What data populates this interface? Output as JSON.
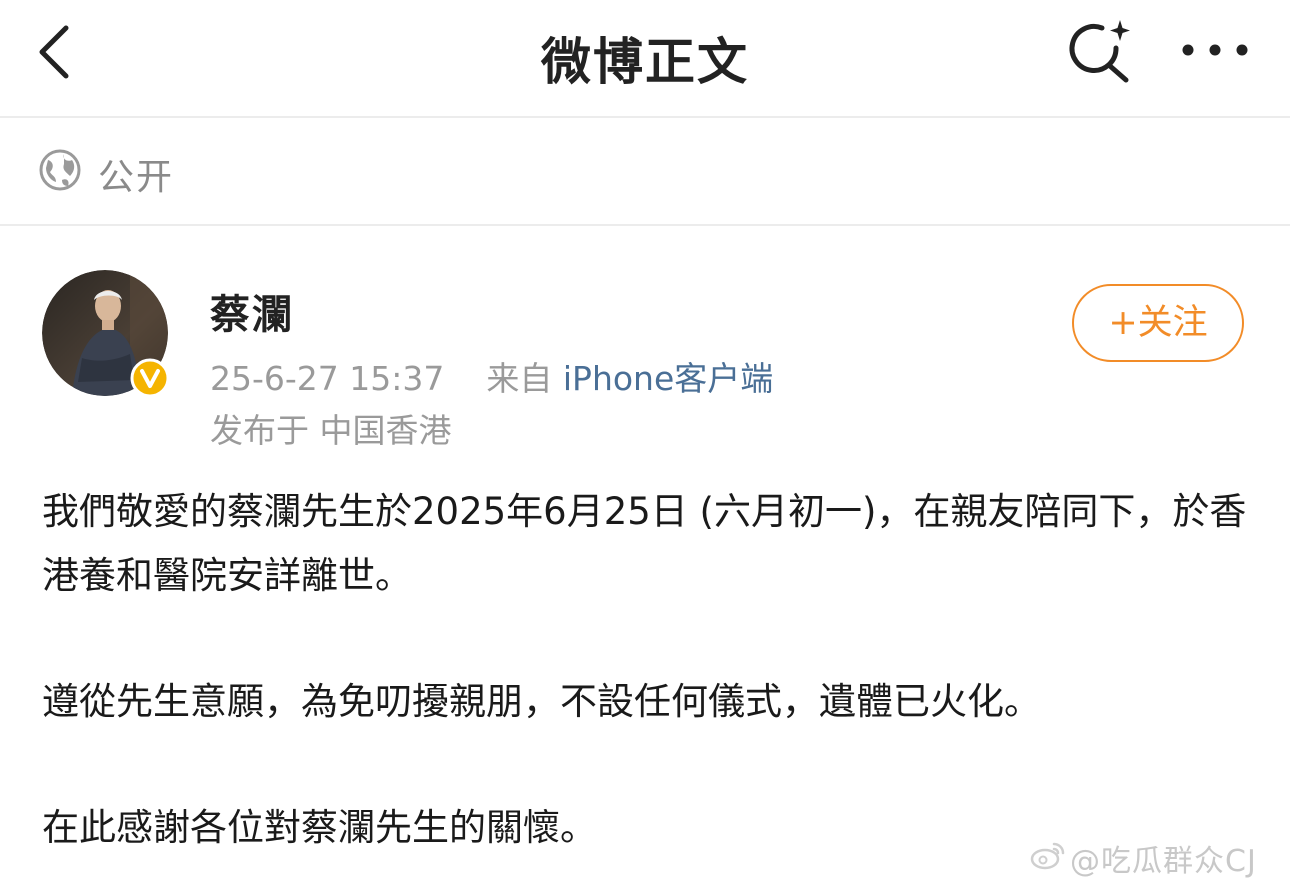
{
  "header": {
    "title": "微博正文",
    "back_icon": "chevron-left-icon",
    "search_icon": "sparkle-search-icon",
    "more_icon": "more-horizontal-icon"
  },
  "visibility": {
    "icon": "globe-icon",
    "label": "公开"
  },
  "author": {
    "name": "蔡瀾",
    "verified": true,
    "verified_badge_color": "#f5b400",
    "timestamp": "25-6-27 15:37",
    "source_prefix": "来自",
    "source": "iPhone客户端",
    "location": "发布于 中国香港",
    "follow_label": "+关注"
  },
  "post": {
    "paragraphs": [
      "我們敬愛的蔡瀾先生於2025年6月25日 (六月初一)，在親友陪同下，於香港養和醫院安詳離世。",
      "遵從先生意願，為免叨擾親朋，不設任何儀式，遺體已火化。",
      "在此感謝各位對蔡瀾先生的關懷。"
    ]
  },
  "watermark": {
    "text": "@吃瓜群众CJ"
  },
  "colors": {
    "accent": "#f28c28",
    "link": "#4a6f96",
    "muted": "#9a9a9a",
    "divider": "#ececec"
  }
}
